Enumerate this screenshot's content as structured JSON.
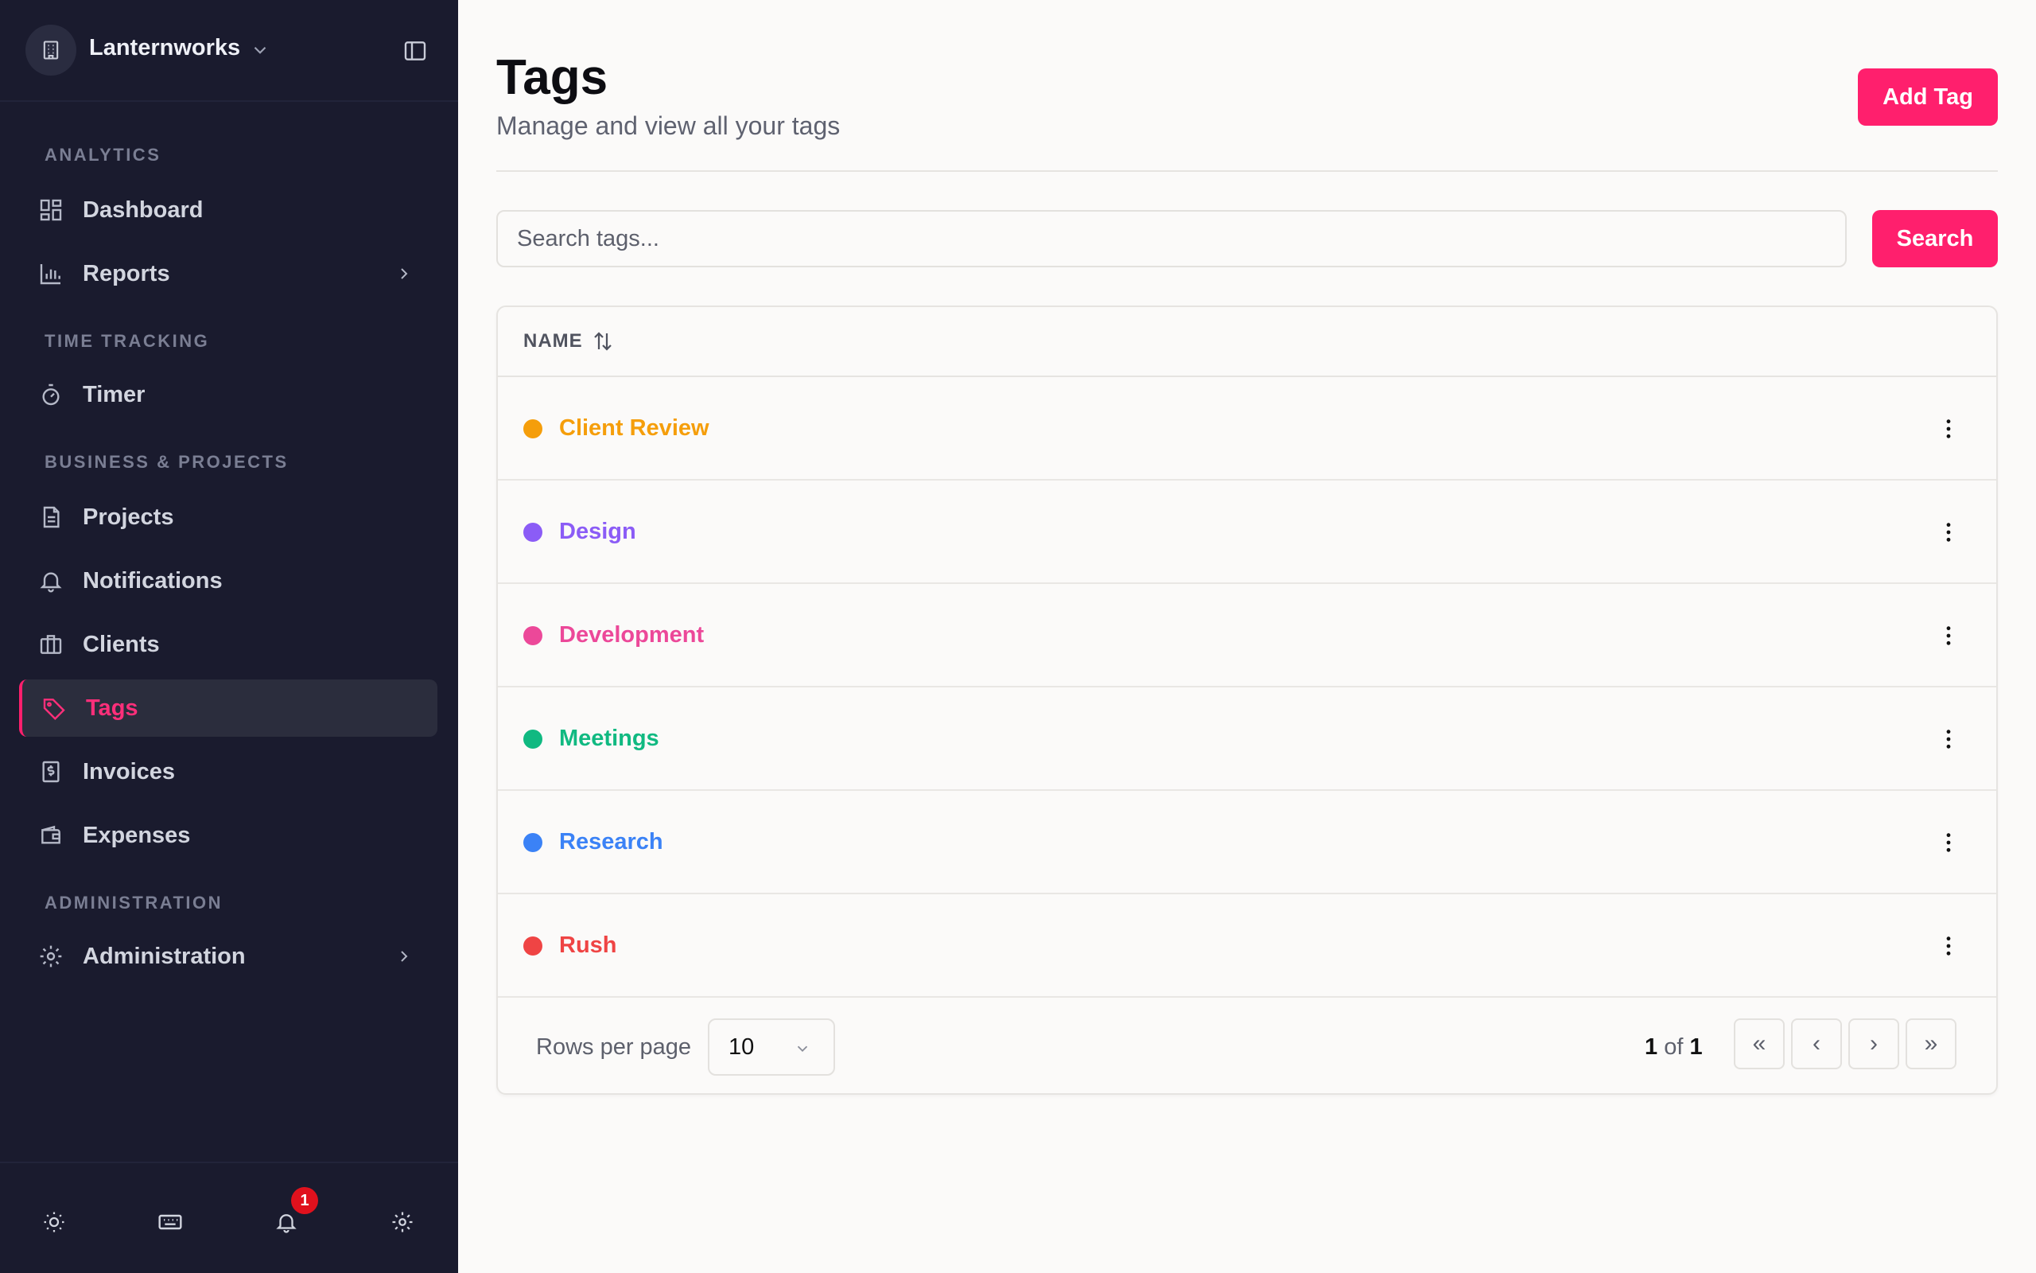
{
  "workspace": {
    "name": "Lanternworks"
  },
  "sidebar": {
    "sections": [
      {
        "label": "ANALYTICS"
      },
      {
        "label": "TIME TRACKING"
      },
      {
        "label": "BUSINESS & PROJECTS"
      },
      {
        "label": "ADMINISTRATION"
      }
    ],
    "items": [
      {
        "label": "Dashboard",
        "icon": "dashboard-icon"
      },
      {
        "label": "Reports",
        "icon": "bar-chart-icon"
      },
      {
        "label": "Timer",
        "icon": "stopwatch-icon"
      },
      {
        "label": "Projects",
        "icon": "document-icon"
      },
      {
        "label": "Notifications",
        "icon": "bell-icon"
      },
      {
        "label": "Clients",
        "icon": "briefcase-icon"
      },
      {
        "label": "Tags",
        "icon": "tag-icon",
        "active": true
      },
      {
        "label": "Invoices",
        "icon": "receipt-icon"
      },
      {
        "label": "Expenses",
        "icon": "wallet-icon"
      },
      {
        "label": "Administration",
        "icon": "gear-icon"
      }
    ],
    "footer": {
      "notification_count": "1"
    }
  },
  "header": {
    "title": "Tags",
    "subtitle": "Manage and view all your tags",
    "add_label": "Add Tag"
  },
  "search": {
    "placeholder": "Search tags...",
    "button_label": "Search"
  },
  "table": {
    "column_name": "NAME",
    "rows": [
      {
        "name": "Client Review",
        "color": "#f59e0b"
      },
      {
        "name": "Design",
        "color": "#8b5cf6"
      },
      {
        "name": "Development",
        "color": "#ec4899"
      },
      {
        "name": "Meetings",
        "color": "#10b981"
      },
      {
        "name": "Research",
        "color": "#3b82f6"
      },
      {
        "name": "Rush",
        "color": "#ef4444"
      }
    ]
  },
  "pagination": {
    "rows_per_page_label": "Rows per page",
    "rows_per_page": "10",
    "current_page": "1",
    "of_label": "of",
    "total_pages": "1",
    "first": "«",
    "prev": "‹",
    "next": "›",
    "last": "»"
  },
  "colors": {
    "accent": "#ff1f6d",
    "sidebar_bg": "#1a1b2e",
    "page_bg": "#fbfaf9"
  }
}
